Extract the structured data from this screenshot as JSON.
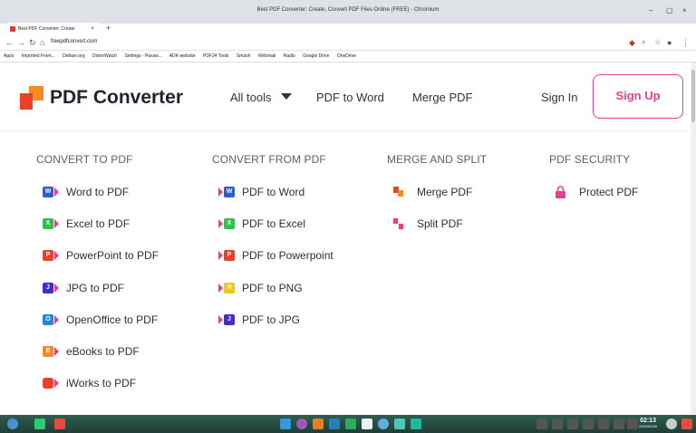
{
  "browser": {
    "window_title": "Best PDF Converter: Create, Convert PDF Files Online (FREE) - Chromium",
    "tab_title": "Best PDF Converter: Create",
    "url": "freepdfconvert.com",
    "bookmarks": [
      "Apps",
      "Imported From...",
      "Debian.org",
      "DistroWatch",
      "Settings - Passw...",
      "ADK-website",
      "PDF24 Tools",
      "Smash",
      "Webmail",
      "Radio",
      "Google Drive",
      "OneDrive"
    ]
  },
  "header": {
    "brand": "PDF Converter",
    "nav": {
      "all_tools": "All tools",
      "pdf_to_word": "PDF to Word",
      "merge_pdf": "Merge PDF",
      "sign_in": "Sign In",
      "sign_up": "Sign Up"
    }
  },
  "menu": {
    "convert_to": {
      "heading": "CONVERT TO PDF",
      "items": [
        "Word to PDF",
        "Excel to PDF",
        "PowerPoint to PDF",
        "JPG to PDF",
        "OpenOffice to PDF",
        "eBooks to PDF",
        "iWorks to PDF"
      ]
    },
    "convert_from": {
      "heading": "CONVERT FROM PDF",
      "items": [
        "PDF to Word",
        "PDF to Excel",
        "PDF to Powerpoint",
        "PDF to PNG",
        "PDF to JPG"
      ]
    },
    "merge_split": {
      "heading": "MERGE AND SPLIT",
      "items": [
        "Merge PDF",
        "Split PDF"
      ]
    },
    "security": {
      "heading": "PDF SECURITY",
      "items": [
        "Protect PDF"
      ]
    }
  },
  "icons": {
    "word": "W",
    "excel": "X",
    "powerpoint": "P",
    "jpg": "J",
    "openoffice": "O",
    "ebooks": "E",
    "png": "N",
    "jpg_out": "J"
  },
  "colors": {
    "accent": "#e83e8c",
    "word": "#2b5cd6",
    "excel": "#31c14a",
    "powerpoint": "#e8412c",
    "jpg": "#3d2fd6",
    "openoffice": "#1e88e5",
    "ebooks": "#f28b24",
    "png": "#f5c518",
    "iworks": "#e8412c"
  },
  "taskbar": {
    "clock_time": "02:13",
    "clock_date": "2020/02/09"
  }
}
